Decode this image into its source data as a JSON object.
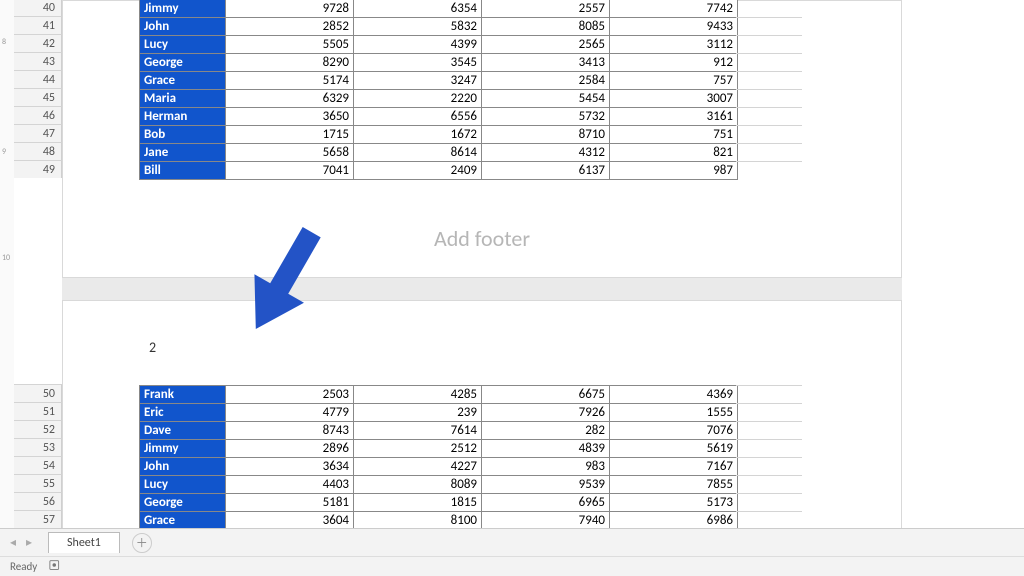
{
  "ruler": {
    "marks": [
      "8",
      "9",
      "10"
    ]
  },
  "row_headers_top": [
    40,
    41,
    42,
    43,
    44,
    45,
    46,
    47,
    48,
    49
  ],
  "row_headers_bottom": [
    50,
    51,
    52,
    53,
    54,
    55,
    56,
    57
  ],
  "table_top": [
    {
      "name": "Jimmy",
      "v": [
        9728,
        6354,
        2557,
        7742
      ]
    },
    {
      "name": "John",
      "v": [
        2852,
        5832,
        8085,
        9433
      ]
    },
    {
      "name": "Lucy",
      "v": [
        5505,
        4399,
        2565,
        3112
      ]
    },
    {
      "name": "George",
      "v": [
        8290,
        3545,
        3413,
        912
      ]
    },
    {
      "name": "Grace",
      "v": [
        5174,
        3247,
        2584,
        757
      ]
    },
    {
      "name": "Maria",
      "v": [
        6329,
        2220,
        5454,
        3007
      ]
    },
    {
      "name": "Herman",
      "v": [
        3650,
        6556,
        5732,
        3161
      ]
    },
    {
      "name": "Bob",
      "v": [
        1715,
        1672,
        8710,
        751
      ]
    },
    {
      "name": "Jane",
      "v": [
        5658,
        8614,
        4312,
        821
      ]
    },
    {
      "name": "Bill",
      "v": [
        7041,
        2409,
        6137,
        987
      ]
    }
  ],
  "table_bottom": [
    {
      "name": "Frank",
      "v": [
        2503,
        4285,
        6675,
        4369
      ]
    },
    {
      "name": "Eric",
      "v": [
        4779,
        239,
        7926,
        1555
      ]
    },
    {
      "name": "Dave",
      "v": [
        8743,
        7614,
        282,
        7076
      ]
    },
    {
      "name": "Jimmy",
      "v": [
        2896,
        2512,
        4839,
        5619
      ]
    },
    {
      "name": "John",
      "v": [
        3634,
        4227,
        983,
        7167
      ]
    },
    {
      "name": "Lucy",
      "v": [
        4403,
        8089,
        9539,
        7855
      ]
    },
    {
      "name": "George",
      "v": [
        5181,
        1815,
        6965,
        5173
      ]
    },
    {
      "name": "Grace",
      "v": [
        3604,
        8100,
        7940,
        6986
      ]
    }
  ],
  "footer_placeholder": "Add footer",
  "page2_header": "2",
  "tabs": {
    "active": "Sheet1"
  },
  "status": {
    "text": "Ready"
  },
  "colors": {
    "name_bg": "#1155cc",
    "arrow": "#2353c6"
  }
}
